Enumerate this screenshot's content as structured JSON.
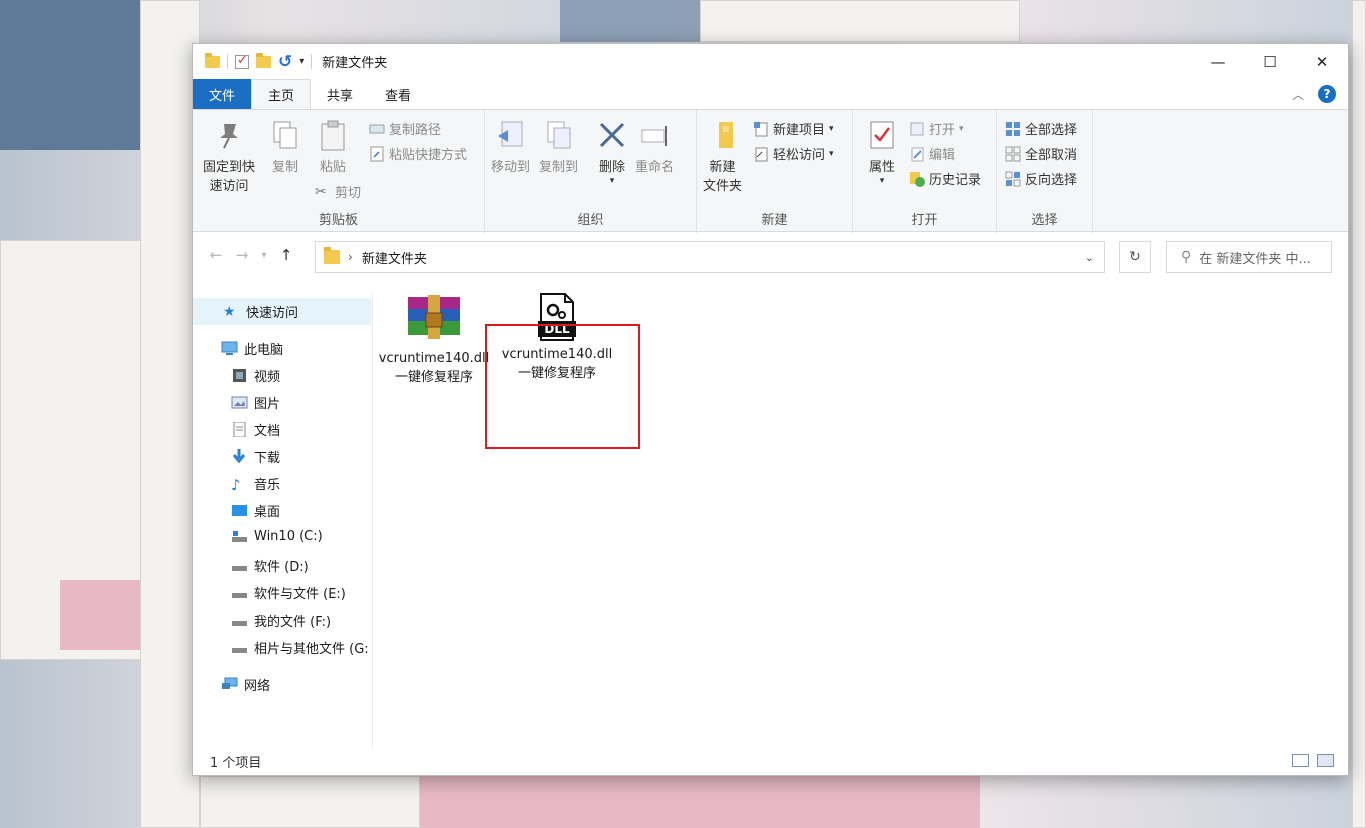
{
  "window": {
    "title": "新建文件夹"
  },
  "ribbon_tabs": [
    "文件",
    "主页",
    "共享",
    "查看"
  ],
  "ribbon": {
    "clipboard": {
      "label": "剪贴板",
      "pin_line1": "固定到快",
      "pin_line2": "速访问",
      "copy": "复制",
      "paste": "粘贴",
      "copy_path": "复制路径",
      "paste_shortcut": "粘贴快捷方式",
      "cut": "剪切"
    },
    "organize": {
      "label": "组织",
      "move_to": "移动到",
      "copy_to": "复制到",
      "delete": "删除",
      "rename": "重命名"
    },
    "new": {
      "label": "新建",
      "new_folder_line1": "新建",
      "new_folder_line2": "文件夹",
      "new_item": "新建项目",
      "easy_access": "轻松访问"
    },
    "open": {
      "label": "打开",
      "properties": "属性",
      "open": "打开",
      "edit": "编辑",
      "history": "历史记录"
    },
    "select": {
      "label": "选择",
      "select_all": "全部选择",
      "select_none": "全部取消",
      "invert": "反向选择"
    }
  },
  "address": {
    "path": "新建文件夹"
  },
  "search": {
    "placeholder": "在 新建文件夹 中..."
  },
  "nav_pane": {
    "quick_access": "快速访问",
    "this_pc": "此电脑",
    "items": [
      "视频",
      "图片",
      "文档",
      "下载",
      "音乐",
      "桌面",
      "Win10 (C:)",
      "软件 (D:)",
      "软件与文件 (E:)",
      "我的文件 (F:)",
      "相片与其他文件 (G:"
    ],
    "network": "网络"
  },
  "files": [
    {
      "name_line1": "vcruntime140.dll",
      "name_line2": "一键修复程序",
      "icon": "winrar-archive-icon"
    },
    {
      "name_line1": "vcruntime140.dll",
      "name_line2": "一键修复程序",
      "icon": "dll-file-icon"
    }
  ],
  "dll_icon_text": "DLL",
  "status": {
    "count": "1 个项目"
  },
  "colors": {
    "accent": "#1a6fc4",
    "highlight": "#e0191f",
    "folder": "#f3c94e"
  }
}
